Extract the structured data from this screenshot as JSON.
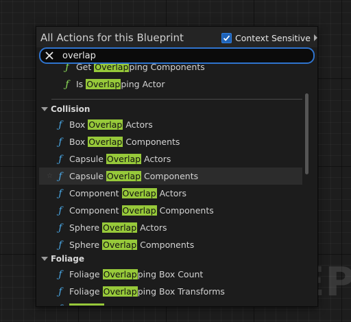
{
  "watermark": "EP",
  "panel": {
    "title": "All Actions for this Blueprint",
    "context_sensitive": {
      "label": "Context Sensitive",
      "checked": true
    }
  },
  "search": {
    "value": "overlap",
    "placeholder": ""
  },
  "list": {
    "top_items": [
      {
        "prefix": "Get ",
        "match": "Overlap",
        "suffix": "ping Components"
      },
      {
        "prefix": "Is ",
        "match": "Overlap",
        "suffix": "ping Actor"
      }
    ],
    "categories": [
      {
        "name": "Collision",
        "items": [
          {
            "prefix": "Box ",
            "match": "Overlap",
            "suffix": " Actors"
          },
          {
            "prefix": "Box ",
            "match": "Overlap",
            "suffix": " Components"
          },
          {
            "prefix": "Capsule ",
            "match": "Overlap",
            "suffix": " Actors"
          },
          {
            "prefix": "Capsule ",
            "match": "Overlap",
            "suffix": " Components",
            "hovered": true
          },
          {
            "prefix": "Component ",
            "match": "Overlap",
            "suffix": " Actors"
          },
          {
            "prefix": "Component ",
            "match": "Overlap",
            "suffix": " Components"
          },
          {
            "prefix": "Sphere ",
            "match": "Overlap",
            "suffix": " Actors"
          },
          {
            "prefix": "Sphere ",
            "match": "Overlap",
            "suffix": " Components"
          }
        ]
      },
      {
        "name": "Foliage",
        "items": [
          {
            "prefix": "Foliage ",
            "match": "Overlap",
            "suffix": "ping Box Count"
          },
          {
            "prefix": "Foliage ",
            "match": "Overlap",
            "suffix": "ping Box Transforms"
          }
        ]
      }
    ]
  },
  "colors": {
    "highlight": "#97c93a",
    "pure_function": "#8ee05a",
    "function": "#4aa8e6",
    "focus": "#2f74cf"
  },
  "icons": {
    "clear": "close-icon",
    "function": "function-icon",
    "favorite": "star-icon",
    "check": "checkmark-icon"
  }
}
